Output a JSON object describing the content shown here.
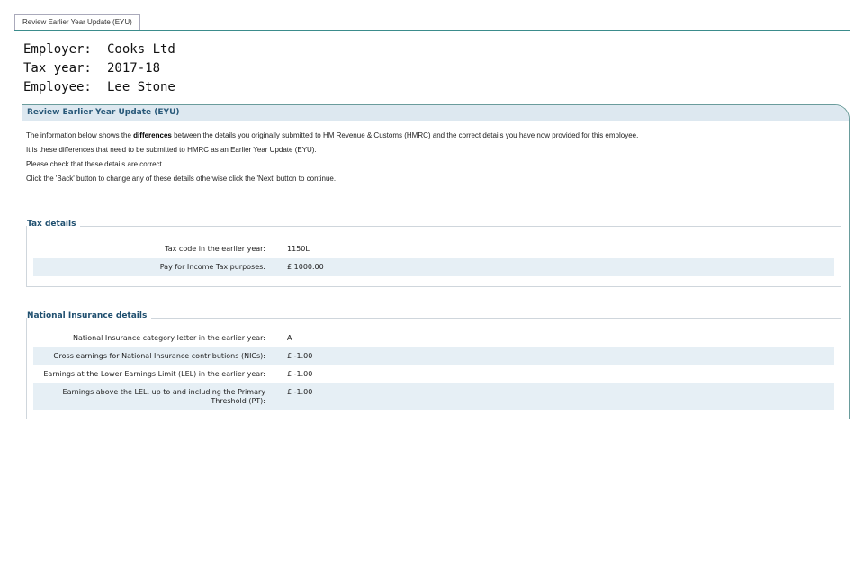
{
  "tab": {
    "label": "Review Earlier Year Update (EYU)"
  },
  "header": {
    "employer_label": "Employer:",
    "employer_value": "Cooks Ltd",
    "taxyear_label": "Tax year:",
    "taxyear_value": "2017-18",
    "employee_label": "Employee:",
    "employee_value": "Lee Stone"
  },
  "panel": {
    "title": "Review Earlier Year Update (EYU)",
    "intro": {
      "line1_pre": "The information below shows the ",
      "line1_bold": "differences",
      "line1_post": " between the details you originally submitted to HM Revenue & Customs (HMRC) and the correct details you have now provided for this employee.",
      "line2": "It is these differences that need to be submitted to HMRC as an Earlier Year Update (EYU).",
      "line3": "Please check that these details are correct.",
      "line4": "Click the 'Back' button to change any of these details otherwise click the 'Next' button to continue."
    }
  },
  "tax_details": {
    "legend": "Tax details",
    "rows": [
      {
        "label": "Tax code in the earlier year:",
        "value": "1150L"
      },
      {
        "label": "Pay for Income Tax purposes:",
        "value": "£ 1000.00"
      }
    ]
  },
  "ni_details": {
    "legend": "National Insurance details",
    "rows": [
      {
        "label": "National Insurance category letter in the earlier year:",
        "value": "A"
      },
      {
        "label": "Gross earnings for National Insurance contributions (NICs):",
        "value": "£ -1.00"
      },
      {
        "label": "Earnings at the Lower Earnings Limit (LEL) in the earlier year:",
        "value": "£ -1.00"
      },
      {
        "label": "Earnings above the LEL, up to and including the Primary Threshold (PT):",
        "value": "£ -1.00"
      }
    ]
  }
}
